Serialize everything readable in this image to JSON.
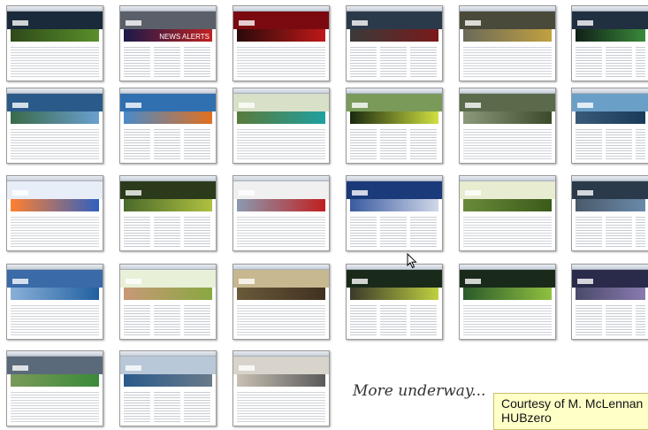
{
  "caption": {
    "more_underway": "More underway...",
    "courtesy_line1": "Courtesy of M. McLennan",
    "courtesy_line2": "HUBzero"
  },
  "thumbnails": [
    {
      "banner_text": "",
      "header": "#1a2a3a",
      "hero": "#2f4a1a",
      "accent": "#5a8f2a"
    },
    {
      "banner_text": "NEWS ALERTS",
      "header": "#5a5f6a",
      "hero": "#1a1a4a",
      "accent": "#c02020"
    },
    {
      "banner_text": "",
      "header": "#7a0a10",
      "hero": "#2a0a0a",
      "accent": "#c01818"
    },
    {
      "banner_text": "",
      "header": "#2a3a4a",
      "hero": "#3a3a3a",
      "accent": "#7a1a1a"
    },
    {
      "banner_text": "",
      "header": "#4a4a3a",
      "hero": "#6a6a5a",
      "accent": "#c2a040"
    },
    {
      "banner_text": "",
      "header": "#203040",
      "hero": "#102018",
      "accent": "#3a8a3a"
    },
    {
      "banner_text": "",
      "header": "#2a5a8a",
      "hero": "#3a6a4a",
      "accent": "#6aa0d0"
    },
    {
      "banner_text": "",
      "header": "#3070b0",
      "hero": "#4a8ac8",
      "accent": "#e07020"
    },
    {
      "banner_text": "",
      "header": "#d8e0c8",
      "hero": "#5a7a3a",
      "accent": "#20a0a0"
    },
    {
      "banner_text": "",
      "header": "#7a9a5a",
      "hero": "#1a2a10",
      "accent": "#d0e040"
    },
    {
      "banner_text": "",
      "header": "#5a6a4a",
      "hero": "#8a9a7a",
      "accent": "#3a4a2a"
    },
    {
      "banner_text": "",
      "header": "#6aa0c8",
      "hero": "#3a5a7a",
      "accent": "#1a3a5a"
    },
    {
      "banner_text": "",
      "header": "#e8eef8",
      "hero": "#ff8030",
      "accent": "#3060c0"
    },
    {
      "banner_text": "",
      "header": "#2a3a1a",
      "hero": "#4a6a2a",
      "accent": "#b0c040"
    },
    {
      "banner_text": "",
      "header": "#f0f0f0",
      "hero": "#8a9ab0",
      "accent": "#c02020"
    },
    {
      "banner_text": "",
      "header": "#1a3a7a",
      "hero": "#3a5aa0",
      "accent": "#d0d8e8"
    },
    {
      "banner_text": "",
      "header": "#e8ecd0",
      "hero": "#6a8a3a",
      "accent": "#3a5a1a"
    },
    {
      "banner_text": "",
      "header": "#2a3a4a",
      "hero": "#4a5a6a",
      "accent": "#6a8aaa"
    },
    {
      "banner_text": "",
      "header": "#3a6aa8",
      "hero": "#8ab0d8",
      "accent": "#2060a0"
    },
    {
      "banner_text": "",
      "header": "#e8f0d8",
      "hero": "#c89878",
      "accent": "#88a840"
    },
    {
      "banner_text": "",
      "header": "#c8b890",
      "hero": "#6a5a3a",
      "accent": "#403020"
    },
    {
      "banner_text": "",
      "header": "#1a2a1a",
      "hero": "#3a3a2a",
      "accent": "#c0d040"
    },
    {
      "banner_text": "",
      "header": "#1a2a1a",
      "hero": "#2a5a2a",
      "accent": "#90c040"
    },
    {
      "banner_text": "",
      "header": "#2a2a4a",
      "hero": "#4a4a6a",
      "accent": "#8a7ab0"
    },
    {
      "banner_text": "",
      "header": "#5a6a7a",
      "hero": "#7a9a5a",
      "accent": "#3a8a3a"
    },
    {
      "banner_text": "",
      "header": "#b8c8d8",
      "hero": "#2a5a8a",
      "accent": "#6a7a8a"
    },
    {
      "banner_text": "",
      "header": "#d8d4cc",
      "hero": "#c8c0b4",
      "accent": "#5a5a5a"
    }
  ],
  "colors": {
    "courtesy_bg": "#ffffc8",
    "frame_border": "#9a9a9a"
  },
  "icons": {
    "cursor": "mouse-pointer-icon"
  }
}
